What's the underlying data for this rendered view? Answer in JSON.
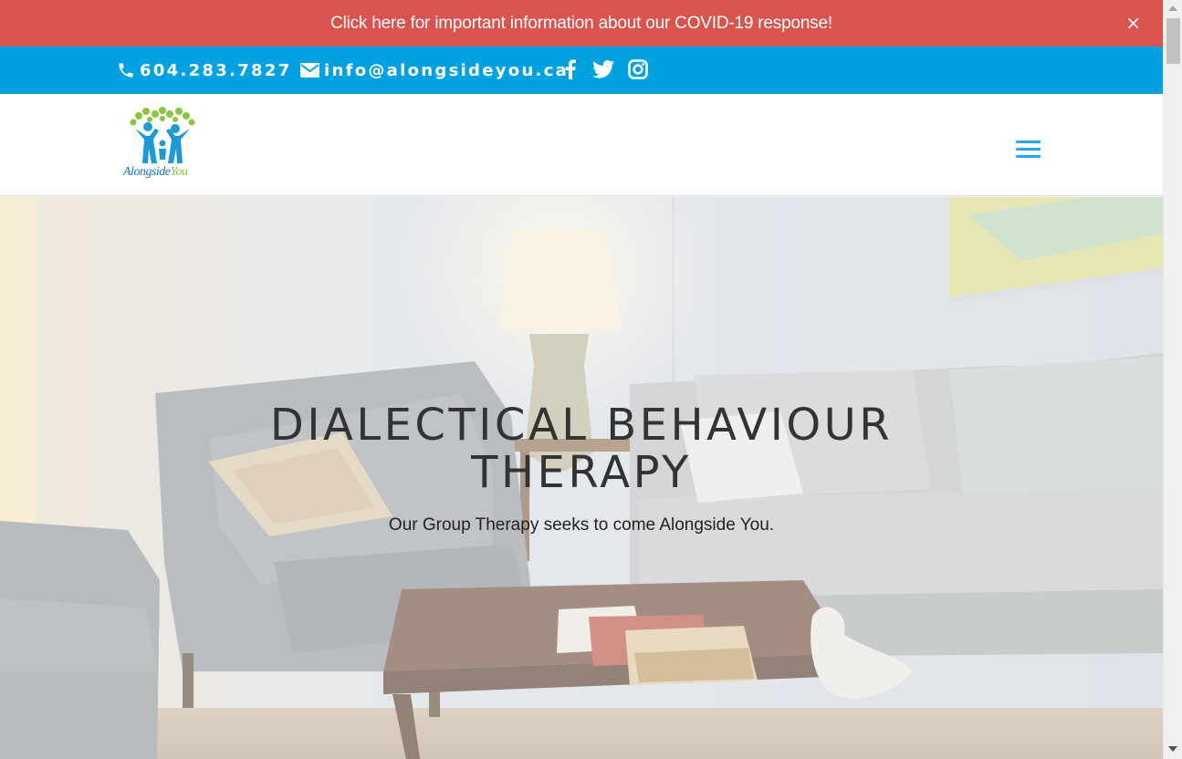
{
  "banner": {
    "text": "Click here for important information about our COVID-19 response!",
    "close_label": "×",
    "bg_color": "#d9534f"
  },
  "top_bar": {
    "bg_color": "#00a1e1",
    "phone": "604.283.7827",
    "email": "info@alongsideyou.ca",
    "icons": [
      "phone-icon",
      "email-icon",
      "facebook-icon",
      "twitter-icon",
      "instagram-icon"
    ]
  },
  "header": {
    "logo_text_primary": "Alongside",
    "logo_text_secondary": "You",
    "menu_icon": "hamburger-menu-icon",
    "accent_color": "#2ea3f2"
  },
  "hero": {
    "title": "DIALECTICAL BEHAVIOUR THERAPY",
    "subtitle": "Our Group Therapy seeks to come Alongside You."
  }
}
